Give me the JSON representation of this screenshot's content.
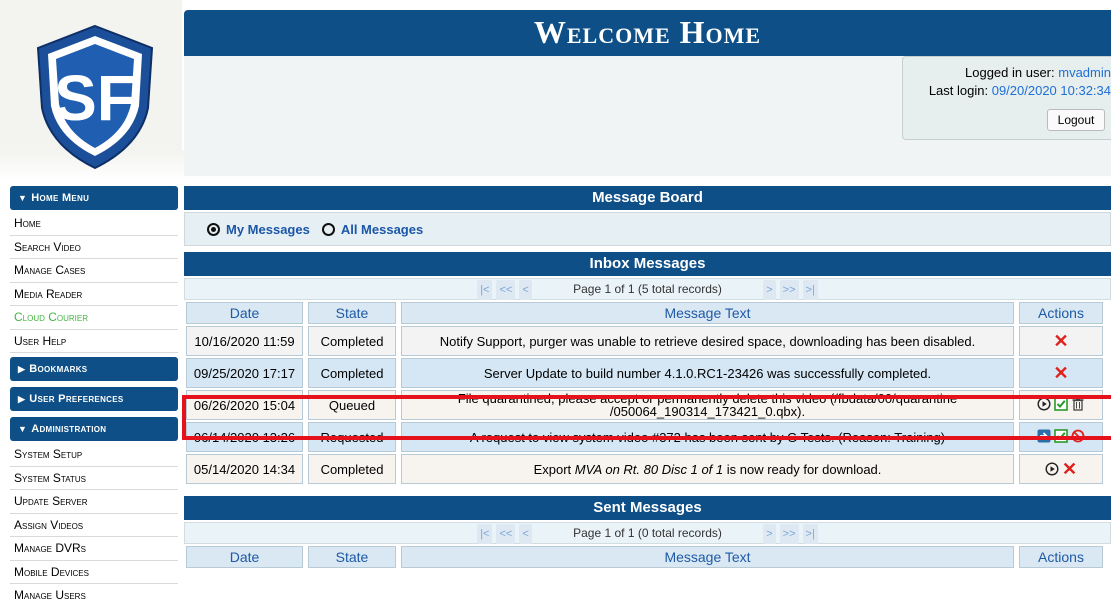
{
  "header": {
    "title": "Welcome Home",
    "logo_text": "SF",
    "login_label": "Logged in user:",
    "login_user": "mvadmin",
    "last_login_label": "Last login:",
    "last_login_value": "09/20/2020 10:32:34",
    "logout_label": "Logout"
  },
  "sidebar": {
    "home_menu": "Home Menu",
    "home_items": [
      "Home",
      "Search Video",
      "Manage Cases",
      "Media Reader",
      "Cloud Courier",
      "User Help"
    ],
    "bookmarks": "Bookmarks",
    "user_prefs": "User Preferences",
    "administration": "Administration",
    "admin_items": [
      "System Setup",
      "System Status",
      "Update Server",
      "Assign Videos",
      "Manage DVRs",
      "Mobile Devices",
      "Manage Users"
    ]
  },
  "board": {
    "title": "Message Board",
    "my_messages": "My Messages",
    "all_messages": "All Messages",
    "selected": "my_messages"
  },
  "inbox": {
    "title": "Inbox Messages",
    "pager": "Page 1 of 1 (5 total records)",
    "columns": [
      "Date",
      "State",
      "Message Text",
      "Actions"
    ],
    "rows": [
      {
        "date": "10/16/2020 11:59",
        "state": "Completed",
        "text": "Notify Support, purger was unable to retrieve desired space, downloading has been disabled.",
        "actions": [
          "delete-icon"
        ]
      },
      {
        "date": "09/25/2020 17:17",
        "state": "Completed",
        "text": "Server Update to build number 4.1.0.RC1-23426 was successfully completed.",
        "actions": [
          "delete-icon"
        ]
      },
      {
        "date": "06/26/2020 15:04",
        "state": "Queued",
        "text_line1": "File quarantined, please accept or permanently delete this video (/fbdata/00/quarantine",
        "text_line2": "/050064_190314_173421_0.qbx).",
        "actions": [
          "play-icon",
          "accept-icon",
          "trash-icon"
        ]
      },
      {
        "date": "06/14/2020 13:26",
        "state": "Requested",
        "text": "A request to view system video #372 has been sent by G Tests. (Reason: Training)",
        "actions": [
          "forward-icon",
          "accept-icon",
          "deny-icon"
        ]
      },
      {
        "date": "05/14/2020 14:34",
        "state": "Completed",
        "text_pre": "Export ",
        "text_em": "MVA on Rt. 80 Disc 1 of 1",
        "text_post": " is now ready for download.",
        "actions": [
          "play-icon",
          "delete-icon"
        ]
      }
    ]
  },
  "sent": {
    "title": "Sent Messages",
    "pager": "Page 1 of 1 (0 total records)",
    "columns": [
      "Date",
      "State",
      "Message Text",
      "Actions"
    ]
  },
  "pager_nav": {
    "first": "|<",
    "prev_page": "<<",
    "prev": "<",
    "next": ">",
    "next_page": ">>",
    "last": ">|"
  },
  "colors": {
    "brand_blue": "#0d4f86",
    "highlight_red": "#e5121b",
    "delete_red": "#e0201a",
    "accept_green": "#2a9a2a",
    "link_blue": "#1e6fd6"
  }
}
